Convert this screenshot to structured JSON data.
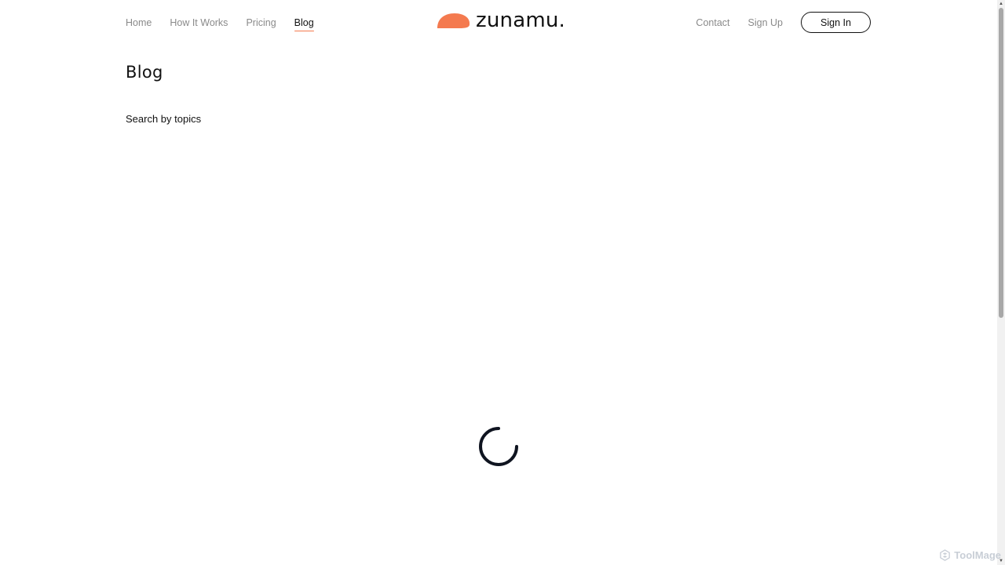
{
  "nav": {
    "left": [
      {
        "label": "Home"
      },
      {
        "label": "How It Works"
      },
      {
        "label": "Pricing"
      },
      {
        "label": "Blog",
        "active": true
      }
    ],
    "right": [
      {
        "label": "Contact"
      },
      {
        "label": "Sign Up"
      }
    ],
    "signin_label": "Sign In"
  },
  "logo": {
    "text": "zunamu.",
    "mark_color": "#f47a4f"
  },
  "page": {
    "title": "Blog",
    "search_label": "Search by topics"
  },
  "loading_icon": "spinner-icon",
  "watermark": {
    "text": "ToolMage",
    "icon": "toolmage-logo-icon"
  },
  "colors": {
    "accent": "#f47a4f",
    "text": "#111111",
    "muted": "#8a8a8a"
  }
}
